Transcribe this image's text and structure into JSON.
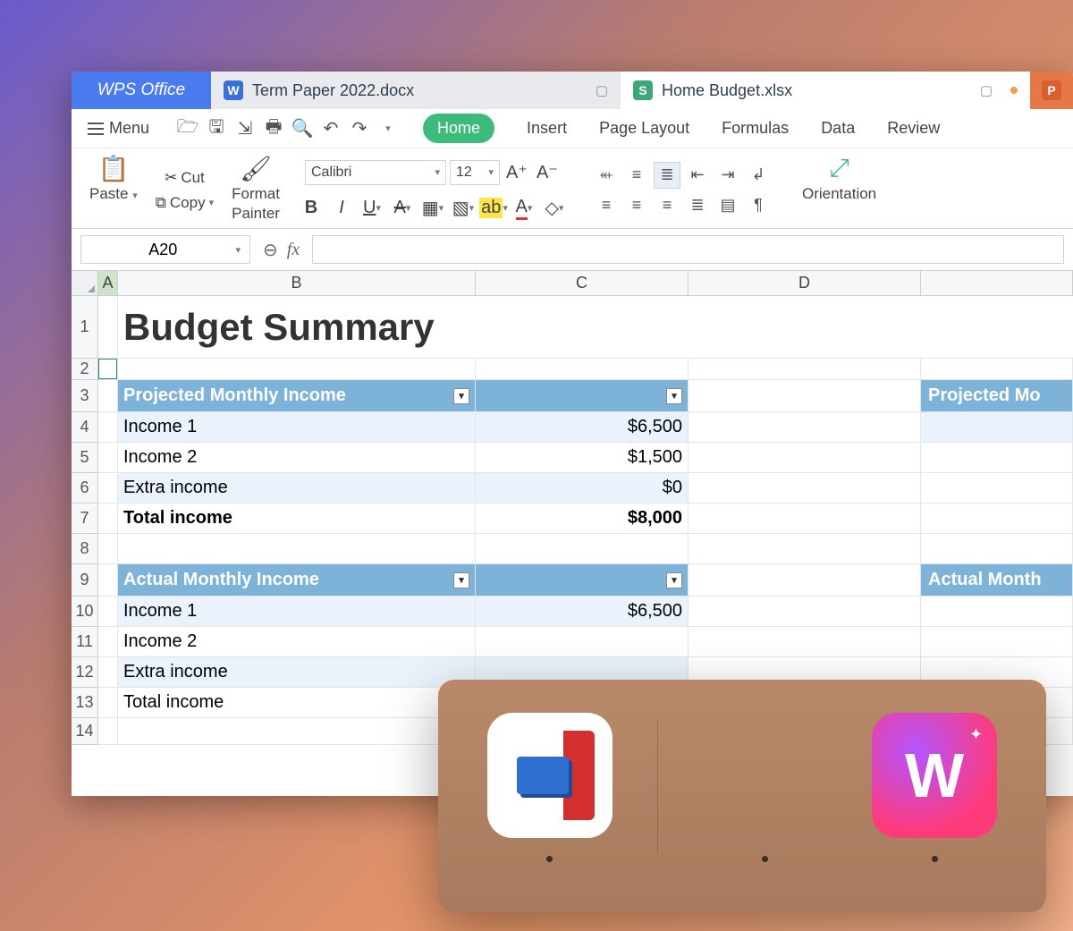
{
  "tabs": {
    "home_label": "WPS Office",
    "doc1": {
      "icon": "W",
      "name": "Term Paper 2022.docx"
    },
    "doc2": {
      "icon": "S",
      "name": "Home Budget.xlsx"
    },
    "ppt_icon": "P"
  },
  "menu": {
    "label": "Menu"
  },
  "ribbon_tabs": {
    "home": "Home",
    "insert": "Insert",
    "page": "Page Layout",
    "formulas": "Formulas",
    "data": "Data",
    "review": "Review"
  },
  "clipboard": {
    "paste": "Paste",
    "cut": "Cut",
    "copy": "Copy",
    "painter_l1": "Format",
    "painter_l2": "Painter"
  },
  "font": {
    "name": "Calibri",
    "size": "12"
  },
  "orientation": "Orientation",
  "namebox": "A20",
  "fx_label": "fx",
  "columns": {
    "A": "A",
    "B": "B",
    "C": "C",
    "D": "D"
  },
  "sheet": {
    "title": "Budget Summary",
    "sec1_header": "Projected Monthly Income",
    "sec1_header_right": "Projected Mo",
    "sec1_rows": [
      {
        "label": "Income 1",
        "value": "$6,500"
      },
      {
        "label": "Income 2",
        "value": "$1,500"
      },
      {
        "label": "Extra income",
        "value": "$0"
      },
      {
        "label": "Total income",
        "value": "$8,000",
        "bold": true
      }
    ],
    "sec2_header": "Actual Monthly Income",
    "sec2_header_right": "Actual Month",
    "sec2_rows": [
      {
        "label": "Income 1",
        "value": "$6,500"
      },
      {
        "label": "Income 2",
        "value": ""
      },
      {
        "label": "Extra income",
        "value": ""
      },
      {
        "label": "Total income",
        "value": ""
      }
    ],
    "row_numbers": [
      "1",
      "2",
      "3",
      "4",
      "5",
      "6",
      "7",
      "8",
      "9",
      "10",
      "11",
      "12",
      "13",
      "14"
    ]
  }
}
